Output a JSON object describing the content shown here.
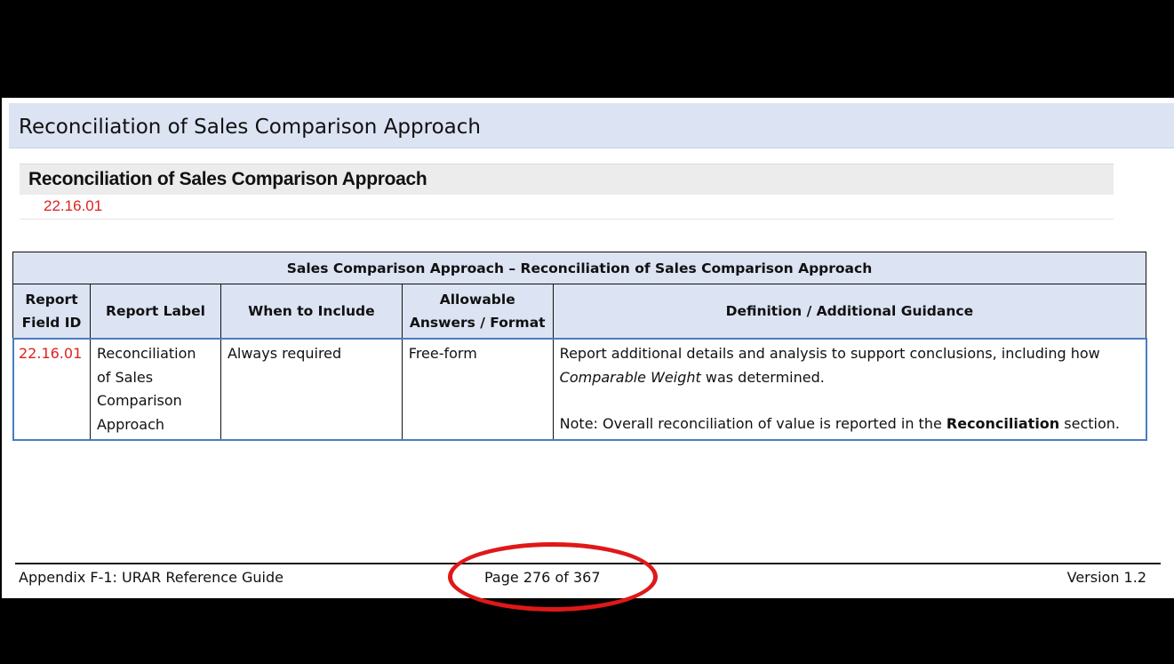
{
  "section": {
    "title": "Reconciliation of Sales Comparison Approach"
  },
  "field": {
    "title": "Reconciliation of Sales Comparison Approach",
    "id": "22.16.01"
  },
  "table": {
    "span_title": "Sales Comparison Approach – Reconciliation of Sales Comparison Approach",
    "headers": {
      "field_id": [
        "Report",
        "Field ID"
      ],
      "label": "Report Label",
      "when": "When to Include",
      "format": [
        "Allowable",
        "Answers / Format"
      ],
      "definition": "Definition / Additional Guidance"
    },
    "rows": [
      {
        "field_id": "22.16.01",
        "label_lines": [
          "Reconciliation",
          "of Sales",
          "Comparison",
          "Approach"
        ],
        "when": "Always required",
        "format": "Free-form",
        "definition": {
          "line1": "Report additional details and analysis to support conclusions, including how",
          "line2_em": "Comparable Weight",
          "line2_rest": " was determined.",
          "note_pre": "Note: Overall reconciliation of value is reported in the ",
          "note_bold": "Reconciliation",
          "note_post": " section."
        }
      }
    ]
  },
  "footer": {
    "left": "Appendix F-1: URAR Reference Guide",
    "center": "Page 276 of 367",
    "right": "Version 1.2"
  },
  "annotation": {
    "color": "#e01818",
    "shape": "ellipse"
  }
}
